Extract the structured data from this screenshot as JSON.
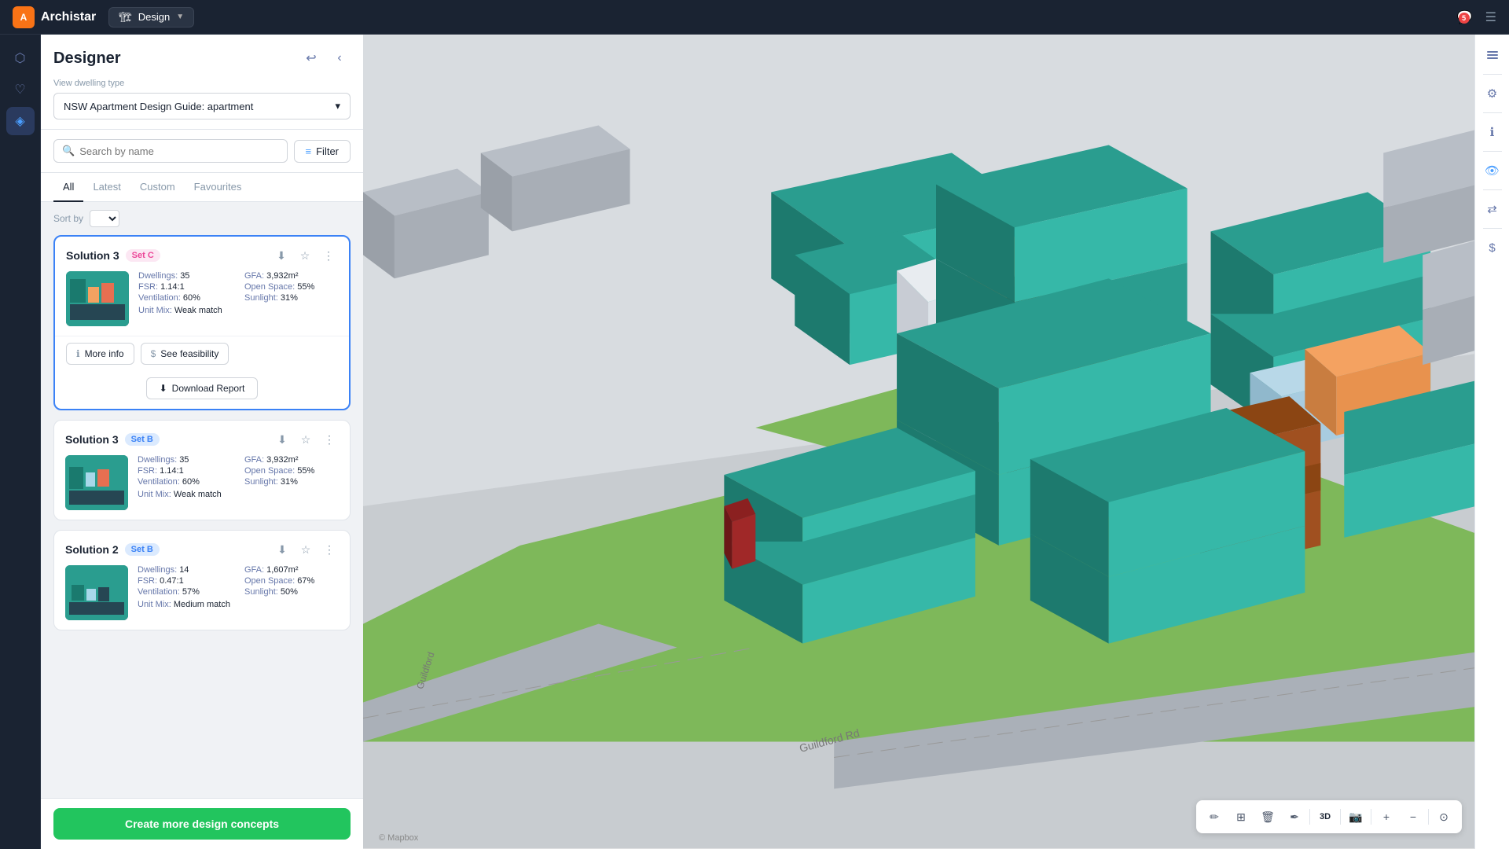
{
  "app": {
    "name": "Archistar",
    "mode": "Design",
    "mode_icon": "🏗"
  },
  "nav": {
    "chat_icon": "💬",
    "menu_icon": "☰",
    "badge_count": "5"
  },
  "panel": {
    "title": "Designer",
    "back_icon": "↩",
    "collapse_icon": "‹",
    "dwelling_label": "View dwelling type",
    "dwelling_value": "NSW Apartment Design Guide: apartment",
    "search_placeholder": "Search by name",
    "filter_label": "Filter",
    "tabs": [
      "All",
      "Latest",
      "Custom",
      "Favourites"
    ],
    "active_tab": "All",
    "sort_label": "Sort by",
    "create_btn": "Create more design concepts"
  },
  "solutions": [
    {
      "id": "sol3-setc",
      "title": "Solution 3",
      "set": "Set C",
      "set_class": "set-c",
      "expanded": true,
      "dwellings": "35",
      "fsr": "1.14:1",
      "ventilation": "60%",
      "unit_mix": "Weak match",
      "gfa": "3,932m²",
      "open_space": "55%",
      "sunlight": "31%",
      "more_info": "More info",
      "see_feasibility": "See feasibility",
      "download_report": "Download Report"
    },
    {
      "id": "sol3-setb",
      "title": "Solution 3",
      "set": "Set B",
      "set_class": "set-b",
      "expanded": false,
      "dwellings": "35",
      "fsr": "1.14:1",
      "ventilation": "60%",
      "unit_mix": "Weak match",
      "gfa": "3,932m²",
      "open_space": "55%",
      "sunlight": "31%"
    },
    {
      "id": "sol2-setb",
      "title": "Solution 2",
      "set": "Set B",
      "set_class": "set-b",
      "expanded": false,
      "dwellings": "14",
      "fsr": "0.47:1",
      "ventilation": "57%",
      "unit_mix": "Medium match",
      "gfa": "1,607m²",
      "open_space": "67%",
      "sunlight": "50%"
    }
  ],
  "right_toolbar": {
    "layers_icon": "≡",
    "settings_icon": "⚙",
    "info_icon": "ℹ",
    "eye_icon": "👁",
    "share_icon": "⇄",
    "dollar_icon": "$"
  },
  "bottom_toolbar": {
    "pencil_icon": "✏",
    "grid_icon": "⊞",
    "trash_icon": "🗑",
    "pen_icon": "✒",
    "label_3d": "3D",
    "camera_icon": "📷",
    "plus_icon": "+",
    "minus_icon": "−",
    "locate_icon": "⊙"
  },
  "map": {
    "road_label_1": "Guildford Rd",
    "road_label_2": "Guildford",
    "mapbox_label": "© Mapbox"
  }
}
